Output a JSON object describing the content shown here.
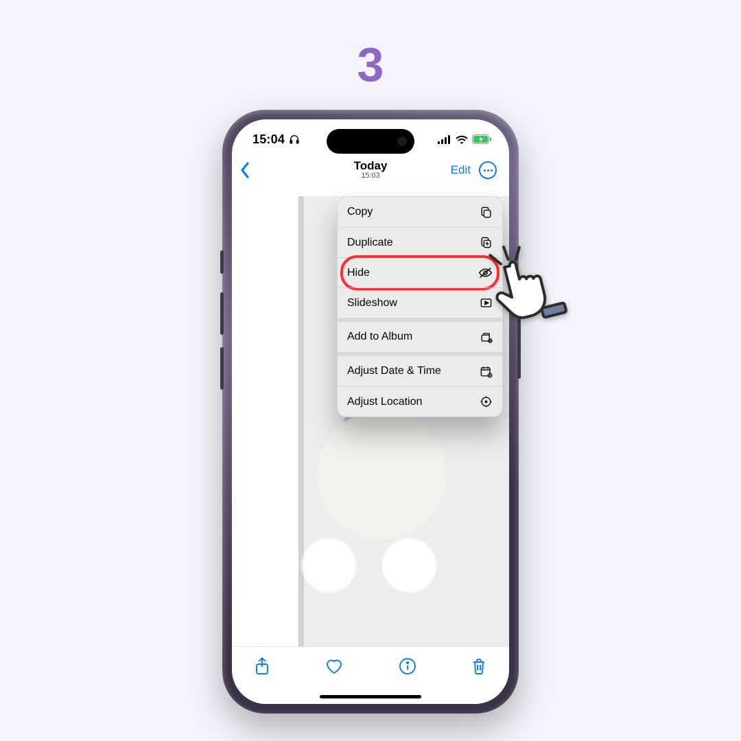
{
  "step_number": "3",
  "status_bar": {
    "time": "15:04",
    "headphone_icon": "headphones-icon"
  },
  "nav": {
    "title": "Today",
    "subtitle": "15:03",
    "edit": "Edit"
  },
  "menu": {
    "groups": [
      [
        {
          "label": "Copy",
          "icon": "copy-icon"
        },
        {
          "label": "Duplicate",
          "icon": "duplicate-icon"
        },
        {
          "label": "Hide",
          "icon": "hide-icon",
          "highlight": true
        },
        {
          "label": "Slideshow",
          "icon": "slideshow-icon"
        }
      ],
      [
        {
          "label": "Add to Album",
          "icon": "album-icon"
        }
      ],
      [
        {
          "label": "Adjust Date & Time",
          "icon": "calendar-icon"
        },
        {
          "label": "Adjust Location",
          "icon": "location-icon"
        }
      ]
    ]
  },
  "photo": {
    "description": "teddy bear by window"
  },
  "colors": {
    "accent": "#8d69c6",
    "ios_blue": "#0a7aff",
    "highlight": "#ff2d2d"
  }
}
